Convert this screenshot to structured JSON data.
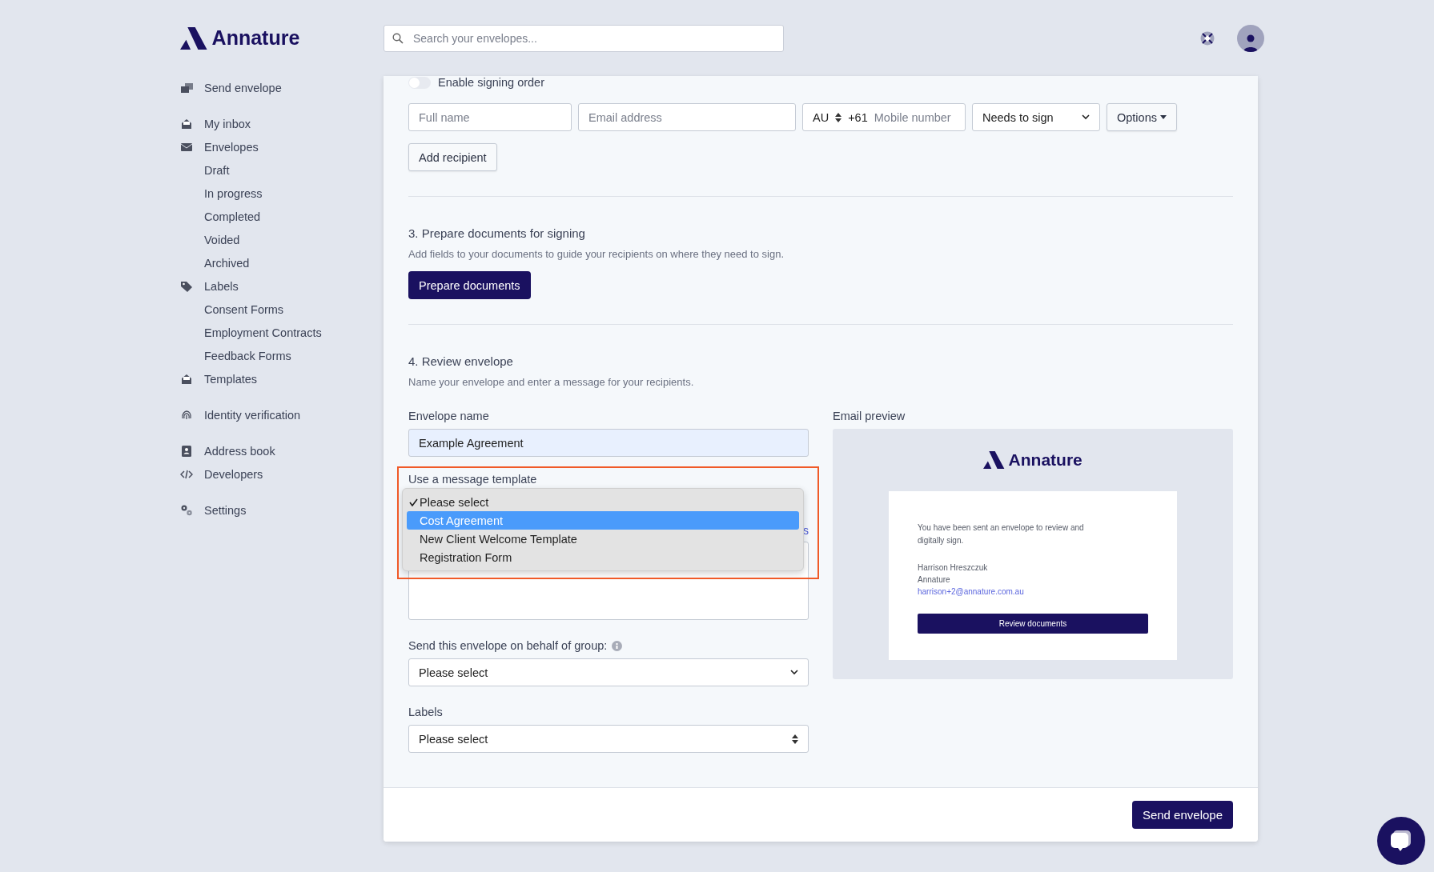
{
  "logo": {
    "name": "Annature"
  },
  "search": {
    "placeholder": "Search your envelopes..."
  },
  "sidebar": {
    "groups": [
      [
        {
          "label": "Send envelope",
          "kind": "send"
        }
      ],
      [
        {
          "label": "My inbox",
          "kind": "inbox"
        },
        {
          "label": "Envelopes",
          "kind": "mail",
          "children": [
            {
              "label": "Draft"
            },
            {
              "label": "In progress"
            },
            {
              "label": "Completed"
            },
            {
              "label": "Voided"
            },
            {
              "label": "Archived"
            }
          ]
        },
        {
          "label": "Labels",
          "kind": "tag",
          "children": [
            {
              "label": "Consent Forms"
            },
            {
              "label": "Employment Contracts"
            },
            {
              "label": "Feedback Forms"
            }
          ]
        },
        {
          "label": "Templates",
          "kind": "inbox"
        }
      ],
      [
        {
          "label": "Identity verification",
          "kind": "fingerprint"
        }
      ],
      [
        {
          "label": "Address book",
          "kind": "book"
        },
        {
          "label": "Developers",
          "kind": "code"
        }
      ],
      [
        {
          "label": "Settings",
          "kind": "gears"
        }
      ]
    ]
  },
  "recipients": {
    "signing_order": {
      "label": "Enable signing order",
      "on": false
    },
    "full_name": {
      "placeholder": "Full name"
    },
    "email": {
      "placeholder": "Email address"
    },
    "phone": {
      "country": "AU",
      "code": "+61",
      "placeholder": "Mobile number"
    },
    "role": {
      "value": "Needs to sign"
    },
    "options_button": "Options",
    "add_button": "Add recipient"
  },
  "prepare": {
    "title": "3. Prepare documents for signing",
    "description": "Add fields to your documents to guide your recipients on where they need to sign.",
    "button": "Prepare documents"
  },
  "review": {
    "title": "4. Review envelope",
    "description": "Name your envelope and enter a message for your recipients.",
    "envelope_name": {
      "label": "Envelope name",
      "value": "Example Agreement"
    },
    "template": {
      "label": "Use a message template",
      "link_fragment": "s",
      "menu": [
        {
          "label": "Please select",
          "checked": true,
          "selected": false
        },
        {
          "label": "Cost Agreement",
          "checked": false,
          "selected": true
        },
        {
          "label": "New Client Welcome Template",
          "checked": false,
          "selected": false
        },
        {
          "label": "Registration Form",
          "checked": false,
          "selected": false
        }
      ]
    },
    "group": {
      "label": "Send this envelope on behalf of group:",
      "value": "Please select"
    },
    "labels": {
      "label": "Labels",
      "value": "Please select"
    }
  },
  "email_preview": {
    "label": "Email preview",
    "brand": "Annature",
    "message": "You have been sent an envelope to review and digitally sign.",
    "sender_name": "Harrison Hreszczuk",
    "sender_org": "Annature",
    "sender_email": "harrison+2@annature.com.au",
    "button": "Review documents"
  },
  "footer": {
    "send_button": "Send envelope"
  }
}
